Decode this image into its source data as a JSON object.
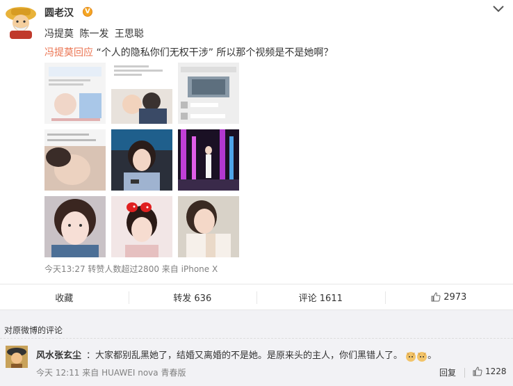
{
  "post": {
    "username": "圆老汉",
    "verified_badge": "V",
    "mentions": [
      "冯提莫",
      "陈一发",
      "王思聪"
    ],
    "repost_link": "冯提莫回应",
    "repost_text": "“个人的隐私你们无权干涉” 所以那个视频是不是她啊？",
    "timestamp": "今天13:27",
    "meta_text": "转赞人数超过2800",
    "source_label": "来自",
    "source": "iPhone X",
    "images": [
      "photo-1",
      "photo-2",
      "photo-3",
      "photo-4",
      "photo-5",
      "photo-6",
      "photo-7",
      "photo-8",
      "photo-9"
    ]
  },
  "actions": {
    "favorite": "收藏",
    "repost": "转发 636",
    "comment": "评论 1611",
    "like_count": "2973"
  },
  "comments": {
    "title": "对原微博的评论",
    "items": [
      {
        "user": "风水张玄尘",
        "text": "：大家都别乱黑她了，结婚又离婚的不是她。是原来头的主人，你们黑错人了。",
        "time": "今天 12:11",
        "source_label": "来自",
        "source": "HUAWEI nova 青春版",
        "reply": "回复",
        "likes": "1228"
      }
    ]
  },
  "colors": {
    "link": "#eb7350",
    "meta": "#808080",
    "comment_bg": "#f2f2f5"
  }
}
